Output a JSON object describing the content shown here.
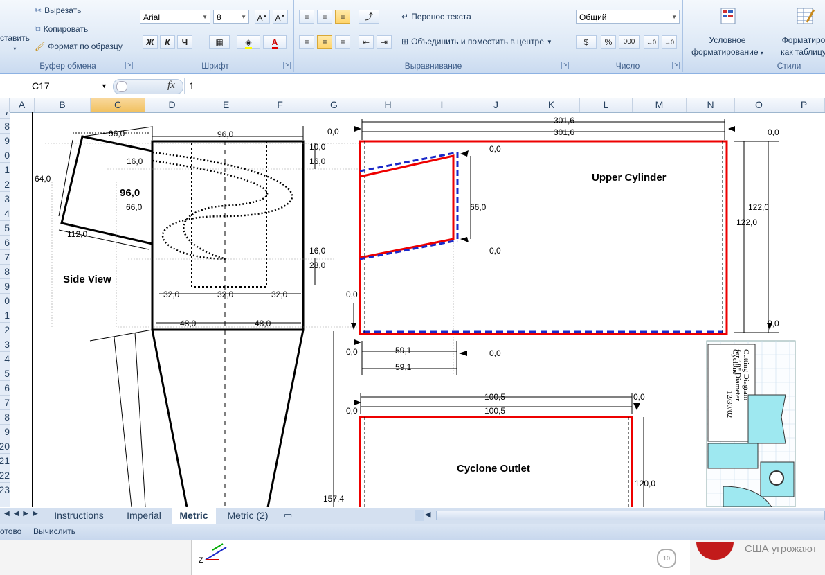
{
  "ribbon": {
    "clipboard": {
      "paste": "ставить",
      "cut": "Вырезать",
      "copy": "Копировать",
      "format_painter": "Формат по образцу",
      "group": "Буфер обмена"
    },
    "font": {
      "name": "Arial",
      "size": "8",
      "group": "Шрифт",
      "bold": "Ж",
      "italic": "К",
      "underline": "Ч"
    },
    "alignment": {
      "wrap": "Перенос текста",
      "merge": "Объединить и поместить в центре",
      "group": "Выравнивание"
    },
    "number": {
      "format": "Общий",
      "currency": "$",
      "percent": "%",
      "thousands": "000",
      "group": "Число"
    },
    "styles": {
      "conditional_1": "Условное",
      "conditional_2": "форматирование",
      "as_table_1": "Форматиро",
      "as_table_2": "как таблицу",
      "group": "Стили"
    }
  },
  "formula_bar": {
    "cell_ref": "C17",
    "fx": "fx",
    "value": "1"
  },
  "columns": [
    "A",
    "B",
    "C",
    "D",
    "E",
    "F",
    "G",
    "H",
    "I",
    "J",
    "K",
    "L",
    "M",
    "N",
    "O",
    "P"
  ],
  "rows": [
    "7",
    "8",
    "9",
    "0",
    "1",
    "2",
    "3",
    "4",
    "5",
    "6",
    "7",
    "8",
    "9",
    "0",
    "1",
    "2",
    "3",
    "4",
    "5",
    "6",
    "7",
    "8",
    "9",
    "20",
    "21",
    "22",
    "23"
  ],
  "drawing": {
    "side_view": "Side View",
    "side_dims": {
      "top_left": "96,0",
      "top": "96,0",
      "r1": "10,0",
      "r2": "16,0",
      "l16": "16,0",
      "left": "64,0",
      "big": "96,0",
      "mid": "66,0",
      "bottom": "112,0",
      "r3": "16,0",
      "r4": "28,0",
      "w1": "32,0",
      "w2": "32,0",
      "w3": "32,0",
      "h1": "48,0",
      "h2": "48,0",
      "z": "0,0"
    },
    "upper_cylinder": {
      "title": "Upper Cylinder",
      "w1": "301,6",
      "w2": "301,6",
      "left0": "0,0",
      "right0": "0,0",
      "h1": "122,0",
      "h2": "122,0",
      "top0": "0,0",
      "inner": "66,0",
      "bot0": "0,0",
      "rb0": "0,0",
      "lb0": "0,0",
      "w3": "59,1",
      "w4": "59,1",
      "w5": "0,0"
    },
    "cyclone_outlet": {
      "title": "Cyclone Outlet",
      "w1": "100,5",
      "w2": "100,5",
      "r0": "0,0",
      "l0": "0,0",
      "h": "120,0",
      "left_h": "157,4"
    },
    "note": {
      "l1": "Cutting Diagram",
      "l2": "for 18\" Diameter",
      "l3": "Cyclone",
      "l4": "12/30/02"
    }
  },
  "tabs": [
    {
      "label": "Instructions"
    },
    {
      "label": "Imperial"
    },
    {
      "label": "Metric"
    },
    {
      "label": "Metric (2)"
    }
  ],
  "status": {
    "ready": "отово",
    "calculate": "Вычислить"
  },
  "taskbar": {
    "news": "США угрожают"
  }
}
